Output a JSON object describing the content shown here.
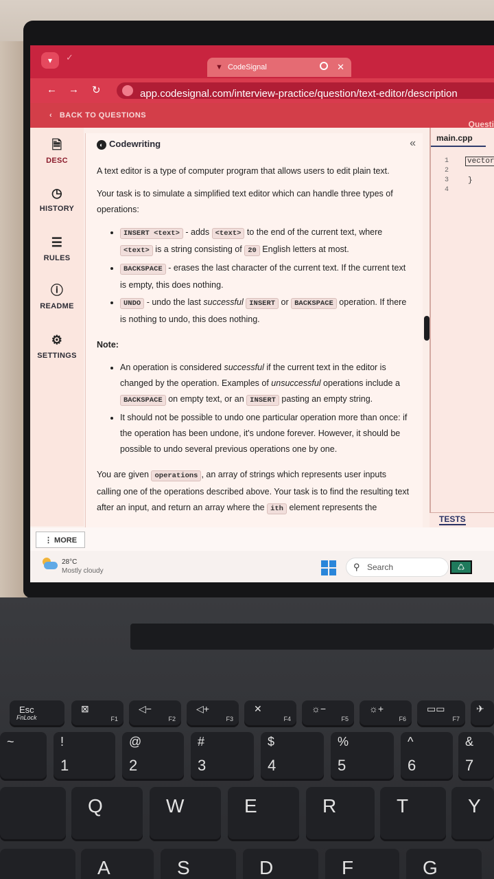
{
  "browser": {
    "tab_title": "CodeSignal",
    "url": "app.codesignal.com/interview-practice/question/text-editor/description"
  },
  "app": {
    "back_label": "BACK TO QUESTIONS",
    "questions_label": "Questi"
  },
  "sidebar": {
    "items": [
      {
        "label": "DESC",
        "icon": "document-icon"
      },
      {
        "label": "HISTORY",
        "icon": "clock-icon"
      },
      {
        "label": "RULES",
        "icon": "list-icon"
      },
      {
        "label": "README",
        "icon": "info-icon"
      },
      {
        "label": "SETTINGS",
        "icon": "gear-icon"
      }
    ]
  },
  "desc": {
    "title": "Codewriting",
    "intro": "A text editor is a type of computer program that allows users to edit plain text.",
    "task": "Your task is to simulate a simplified text editor which can handle three types of operations:",
    "op1_code": "INSERT <text>",
    "op1_a": " - adds ",
    "op1_code2": "<text>",
    "op1_b": " to the end of the current text, where ",
    "op1_code3": "<text>",
    "op1_c": " is a string consisting of ",
    "op1_code4": "20",
    "op1_d": " English letters at most.",
    "op2_code": "BACKSPACE",
    "op2_a": " - erases the last character of the current text. If the current text is empty, this does nothing.",
    "op3_code": "UNDO",
    "op3_a": " - undo the last ",
    "op3_em": "successful",
    "op3_code2": "INSERT",
    "op3_b": " or ",
    "op3_code3": "BACKSPACE",
    "op3_c": " operation. If there is nothing to undo, this does nothing.",
    "note_label": "Note:",
    "n1_a": "An operation is considered ",
    "n1_em": "successful",
    "n1_b": " if the current text in the editor is changed by the operation. Examples of ",
    "n1_em2": "unsuccessful",
    "n1_c": " operations include a ",
    "n1_code": "BACKSPACE",
    "n1_d": " on empty text, or an ",
    "n1_code2": "INSERT",
    "n1_e": " pasting an empty string.",
    "n2": "It should not be possible to undo one particular operation more than once: if the operation has been undone, it's undone forever. However, it should be possible to undo several previous operations one by one.",
    "given_a": "You are given ",
    "given_code": "operations",
    "given_b": ", an array of strings which represents user inputs calling one of the operations described above. Your task is to find the resulting text after an input, and return an array where the ",
    "given_code2": "ith",
    "given_c": " element represents the"
  },
  "editor": {
    "file_tab": "main.cpp",
    "line_numbers": "1\n2\n3\n4",
    "code_line1": "vector<",
    "code_line3": "}",
    "tests_label": "TESTS"
  },
  "more_label": "⋮ MORE",
  "taskbar": {
    "temperature": "28°C",
    "weather": "Mostly cloudy",
    "search_placeholder": "Search"
  },
  "keyboard": {
    "fn_row": [
      {
        "top": "Esc",
        "sub": "FnLock"
      },
      {
        "icon": "⊠",
        "f": "F1"
      },
      {
        "icon": "◁−",
        "f": "F2"
      },
      {
        "icon": "◁+",
        "f": "F3"
      },
      {
        "icon": "✕",
        "f": "F4"
      },
      {
        "icon": "☼−",
        "f": "F5"
      },
      {
        "icon": "☼+",
        "f": "F6"
      },
      {
        "icon": "▭▭",
        "f": "F7"
      },
      {
        "icon": "✈",
        "f": ""
      }
    ],
    "num_row": [
      {
        "top": "~",
        "bottom": ""
      },
      {
        "top": "!",
        "bottom": "1"
      },
      {
        "top": "@",
        "bottom": "2"
      },
      {
        "top": "#",
        "bottom": "3"
      },
      {
        "top": "$",
        "bottom": "4"
      },
      {
        "top": "%",
        "bottom": "5"
      },
      {
        "top": "^",
        "bottom": "6"
      },
      {
        "top": "&",
        "bottom": "7"
      }
    ],
    "qwe_row": [
      "Q",
      "W",
      "E",
      "R",
      "T",
      "Y"
    ],
    "asd_row": [
      "A",
      "S",
      "D",
      "F",
      "G"
    ]
  }
}
